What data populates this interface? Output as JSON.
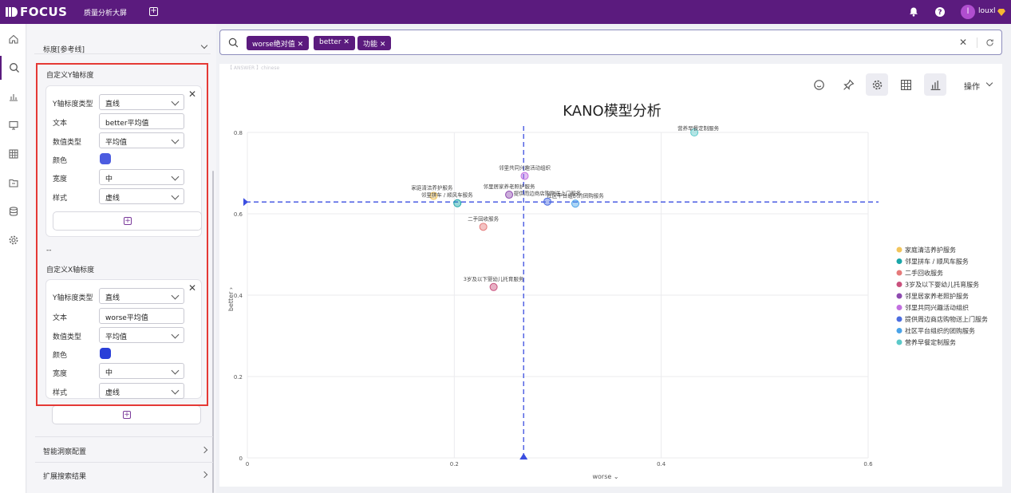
{
  "header": {
    "logo_text": "FOCUS",
    "app_title": "质量分析大屏",
    "username": "louxl",
    "avatar_letter": "l"
  },
  "left_panel": {
    "ref_line_label": "标度[参考线]",
    "y_section_title": "自定义Y轴标度",
    "x_section_title": "自定义X轴标度",
    "separator": "--",
    "y_card": {
      "type_label": "Y轴标度类型",
      "type_value": "直线",
      "text_label": "文本",
      "text_value": "better平均值",
      "value_type_label": "数值类型",
      "value_type_value": "平均值",
      "color_label": "颜色",
      "color": "#4c5ce0",
      "width_label": "宽度",
      "width_value": "中",
      "style_label": "样式",
      "style_value": "虚线"
    },
    "x_card": {
      "type_label": "Y轴标度类型",
      "type_value": "直线",
      "text_label": "文本",
      "text_value": "worse平均值",
      "value_type_label": "数值类型",
      "value_type_value": "平均值",
      "color_label": "颜色",
      "color": "#2a3fd8",
      "width_label": "宽度",
      "width_value": "中",
      "style_label": "样式",
      "style_value": "虚线"
    },
    "accordion": [
      "智能洞察配置",
      "扩展搜索结果"
    ]
  },
  "search": {
    "chips": [
      "worse绝对值",
      "better",
      "功能"
    ]
  },
  "answer_label": "【 ANSWER 】chinese",
  "toolbar": {
    "ops_label": "操作"
  },
  "chart_data": {
    "type": "scatter",
    "title": "KANO模型分析",
    "xlabel": "worse",
    "ylabel": "better",
    "xlim": [
      0,
      0.6
    ],
    "ylim": [
      0,
      0.8
    ],
    "xticks": [
      "0",
      "0.2",
      "0.4",
      "0.6"
    ],
    "yticks": [
      "0",
      "0.2",
      "0.4",
      "0.6",
      "0.8"
    ],
    "legend_position": "right",
    "ref_lines": {
      "x_mean": 0.267,
      "y_mean": 0.629
    },
    "series": [
      {
        "name": "家庭清洁养护服务",
        "color": "#f2c55c",
        "x": 0.18,
        "y": 0.644
      },
      {
        "name": "邻里拼车 / 顺风车服务",
        "color": "#1aa6a8",
        "x": 0.203,
        "y": 0.626
      },
      {
        "name": "二手回收服务",
        "color": "#e57a7a",
        "x": 0.228,
        "y": 0.568
      },
      {
        "name": "3岁及以下婴幼儿托育服务",
        "color": "#c9507d",
        "x": 0.238,
        "y": 0.42
      },
      {
        "name": "邻里居家养老照护服务",
        "color": "#8e4bb0",
        "x": 0.253,
        "y": 0.647
      },
      {
        "name": "邻里共同兴趣活动组织",
        "color": "#c26fe0",
        "x": 0.268,
        "y": 0.693
      },
      {
        "name": "提供周边商店购物送上门服务",
        "color": "#4c6de0",
        "x": 0.29,
        "y": 0.63
      },
      {
        "name": "社区平台组织的团购服务",
        "color": "#4aa3e8",
        "x": 0.317,
        "y": 0.625
      },
      {
        "name": "营养早餐定制服务",
        "color": "#5cc9c9",
        "x": 0.432,
        "y": 0.8
      }
    ],
    "point_labels": [
      "家庭清洁养护服务",
      "邻里拼车 / 顺风车服务",
      "二手回收服务",
      "3岁及以下婴幼儿托育服务",
      "邻里居家养老照护服务",
      "邻里共同兴趣活动组织",
      "提供周边商店购物送上门服务",
      "社区平台组织的团购服务",
      "营养早餐定制服务"
    ]
  }
}
